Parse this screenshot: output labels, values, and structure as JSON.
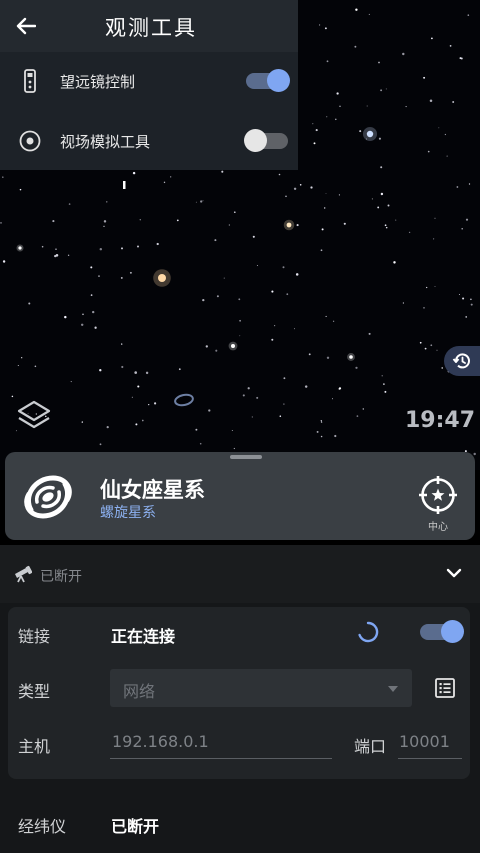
{
  "top_panel": {
    "title": "观测工具",
    "rows": [
      {
        "label": "望远镜控制",
        "toggle": "on"
      },
      {
        "label": "视场模拟工具",
        "toggle": "off"
      }
    ]
  },
  "sky": {
    "time": "19:47"
  },
  "object": {
    "name": "仙女座星系",
    "type": "螺旋星系",
    "center_label": "中心"
  },
  "connection": {
    "status": "已断开",
    "link_label": "链接",
    "link_value": "正在连接",
    "link_toggle": "on",
    "type_label": "类型",
    "type_value": "网络",
    "host_label": "主机",
    "host_placeholder": "192.168.0.1",
    "port_label": "端口",
    "port_placeholder": "10001",
    "gps_label": "经纬仪",
    "gps_value": "已断开"
  },
  "colors": {
    "accent": "#7fa6f2",
    "object_type": "#8cb0ef",
    "panel_bg": "#1d2228"
  }
}
